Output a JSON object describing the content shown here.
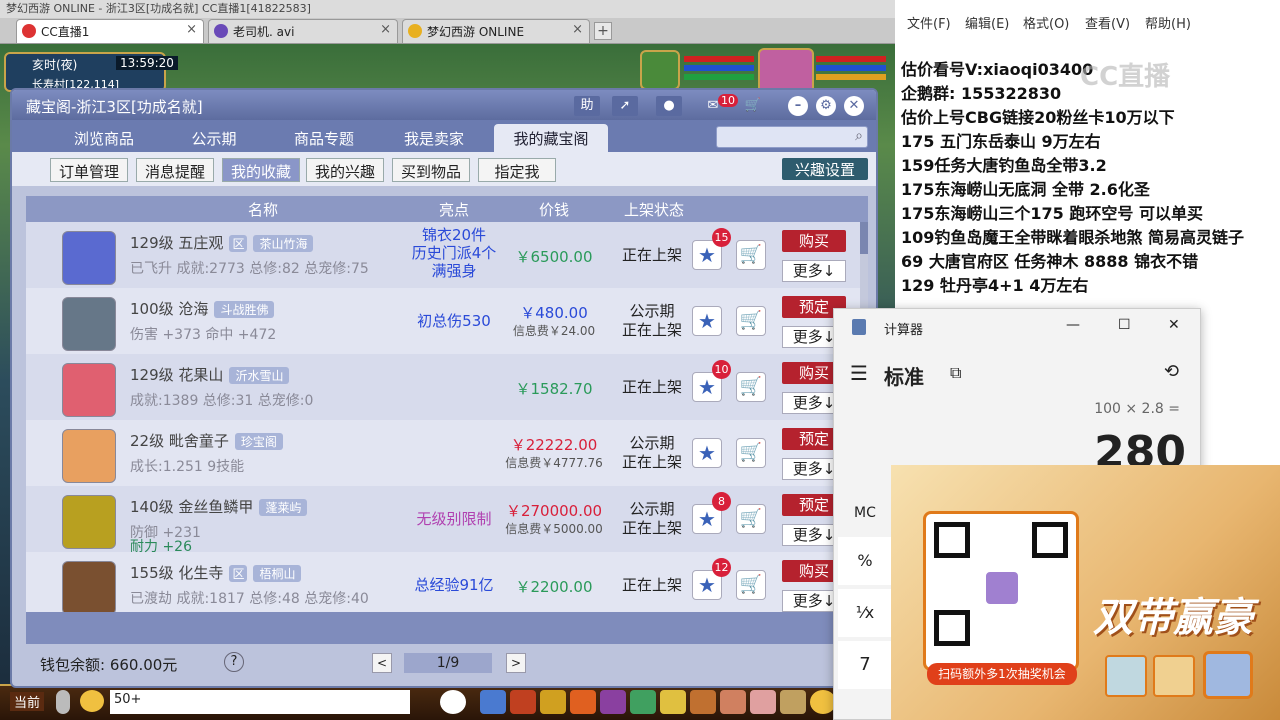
{
  "browser": {
    "top_text": "梦幻西游 ONLINE  - 浙江3区[功成名就]  CC直播1[41822583]",
    "tabs": [
      {
        "label": "CC直播1",
        "active": true
      },
      {
        "label": "老司机. avi",
        "active": false
      },
      {
        "label": "梦幻西游 ONLINE",
        "active": false
      }
    ],
    "close": "×",
    "new_tab": "+"
  },
  "game": {
    "time_label": "亥时(夜)",
    "clock": "13:59:20",
    "location": "长寿村[122,114]",
    "chat_channel": "当前",
    "chat_input": "50+"
  },
  "shop": {
    "title": "藏宝阁-浙江3区[功成名就]",
    "help_btn": "助",
    "mail_count": "10",
    "nav": [
      "浏览商品",
      "公示期",
      "商品专题",
      "我是卖家",
      "我的藏宝阁"
    ],
    "sub": [
      "订单管理",
      "消息提醒",
      "我的收藏",
      "我的兴趣",
      "买到物品",
      "指定我"
    ],
    "interest_btn": "兴趣设置",
    "headers": {
      "name": "名称",
      "highlight": "亮点",
      "price": "价钱",
      "status": "上架状态"
    },
    "rows": [
      {
        "level": "129级",
        "name": "五庄观",
        "tag1": "区",
        "tag2": "茶山竹海",
        "l2": "已飞升 成就:2773 总修:82 总宠修:75",
        "l3": "",
        "hl": [
          "锦衣20件",
          "历史门派4个",
          "满强身"
        ],
        "hl_color": "#2a4ad8",
        "price": "￥6500.00",
        "price_color": "#2a9a5a",
        "fee": "",
        "status": [
          "正在上架"
        ],
        "badge": "15",
        "buy": "购买",
        "more": "更多↓",
        "avatar": "#5a6ad0"
      },
      {
        "level": "100级",
        "name": "沧海",
        "tag1": "",
        "tag2": "斗战胜佛",
        "l2": "伤害 +373 命中 +472",
        "l3": "",
        "hl": [
          "初总伤530"
        ],
        "hl_color": "#2a4ad8",
        "price": "￥480.00",
        "price_color": "#2a4ad8",
        "fee": "信息费￥24.00",
        "status": [
          "公示期",
          "正在上架"
        ],
        "badge": "",
        "buy": "预定",
        "more": "更多↓",
        "avatar": "#667788"
      },
      {
        "level": "129级",
        "name": "花果山",
        "tag1": "",
        "tag2": "沂水雪山",
        "l2": "成就:1389 总修:31 总宠修:0",
        "l3": "",
        "hl": [
          ""
        ],
        "hl_color": "#2a4ad8",
        "price": "￥1582.70",
        "price_color": "#2a9a5a",
        "fee": "",
        "status": [
          "正在上架"
        ],
        "badge": "10",
        "buy": "购买",
        "more": "更多↓",
        "avatar": "#e06070"
      },
      {
        "level": "22级",
        "name": "毗舍童子",
        "tag1": "",
        "tag2": "珍宝阁",
        "l2": "成长:1.251 9技能",
        "l3": "",
        "hl": [
          ""
        ],
        "hl_color": "#2a4ad8",
        "price": "￥22222.00",
        "price_color": "#d8203a",
        "fee": "信息费￥4777.76",
        "status": [
          "公示期",
          "正在上架"
        ],
        "badge": "",
        "buy": "预定",
        "more": "更多↓",
        "avatar": "#e8a060"
      },
      {
        "level": "140级",
        "name": "金丝鱼鳞甲",
        "tag1": "",
        "tag2": "蓬莱屿",
        "l2": "防御 +231",
        "l3": "耐力 +26",
        "hl": [
          "无级别限制"
        ],
        "hl_color": "#b040b0",
        "price": "￥270000.00",
        "price_color": "#d8203a",
        "fee": "信息费￥5000.00",
        "status": [
          "公示期",
          "正在上架"
        ],
        "badge": "8",
        "buy": "预定",
        "more": "更多↓",
        "avatar": "#b8a020"
      },
      {
        "level": "155级",
        "name": "化生寺",
        "tag1": "区",
        "tag2": "梧桐山",
        "l2": "已渡劫 成就:1817 总修:48 总宠修:40",
        "l3": "",
        "hl": [
          "总经验91亿"
        ],
        "hl_color": "#2a4ad8",
        "price": "￥2200.00",
        "price_color": "#2a9a5a",
        "fee": "",
        "status": [
          "正在上架"
        ],
        "badge": "12",
        "buy": "购买",
        "more": "更多↓",
        "avatar": "#7a5030"
      }
    ],
    "wallet": "钱包余额: 660.00元",
    "help": "?",
    "page": "1/9",
    "prev": "<",
    "next": ">"
  },
  "notepad": {
    "menu": [
      "文件(F)",
      "编辑(E)",
      "格式(O)",
      "查看(V)",
      "帮助(H)"
    ],
    "lines": [
      "估价看号V:xiaoqi03400",
      "企鹅群: 155322830",
      "估价上号CBG链接20粉丝卡10万以下",
      "175 五门东岳泰山  9万左右",
      "159任务大唐钓鱼岛全带3.2",
      "175东海崂山无底洞  全带   2.6化圣",
      "175东海崂山三个175 跑环空号 可以单买",
      "109钓鱼岛魔王全带眯着眼杀地煞 简易高灵链子",
      "69  大唐官府区 任务神木 8888 锦衣不错",
      "129 牡丹亭4+1 4万左右"
    ],
    "watermark": "CC直播"
  },
  "calculator": {
    "title": "计算器",
    "mode": "标准",
    "expression": "100 × 2.8 =",
    "result": "280",
    "mc": "MC",
    "keys": [
      "%",
      "¹⁄x",
      "7"
    ],
    "min": "—",
    "max": "☐",
    "close": "✕"
  },
  "promo": {
    "caption": "扫码额外多1次抽奖机会",
    "banner": "双带赢豪"
  },
  "colors": {
    "accent": "#6b7bb0",
    "buy": "#b5222e",
    "interest": "#2e5c6e"
  }
}
